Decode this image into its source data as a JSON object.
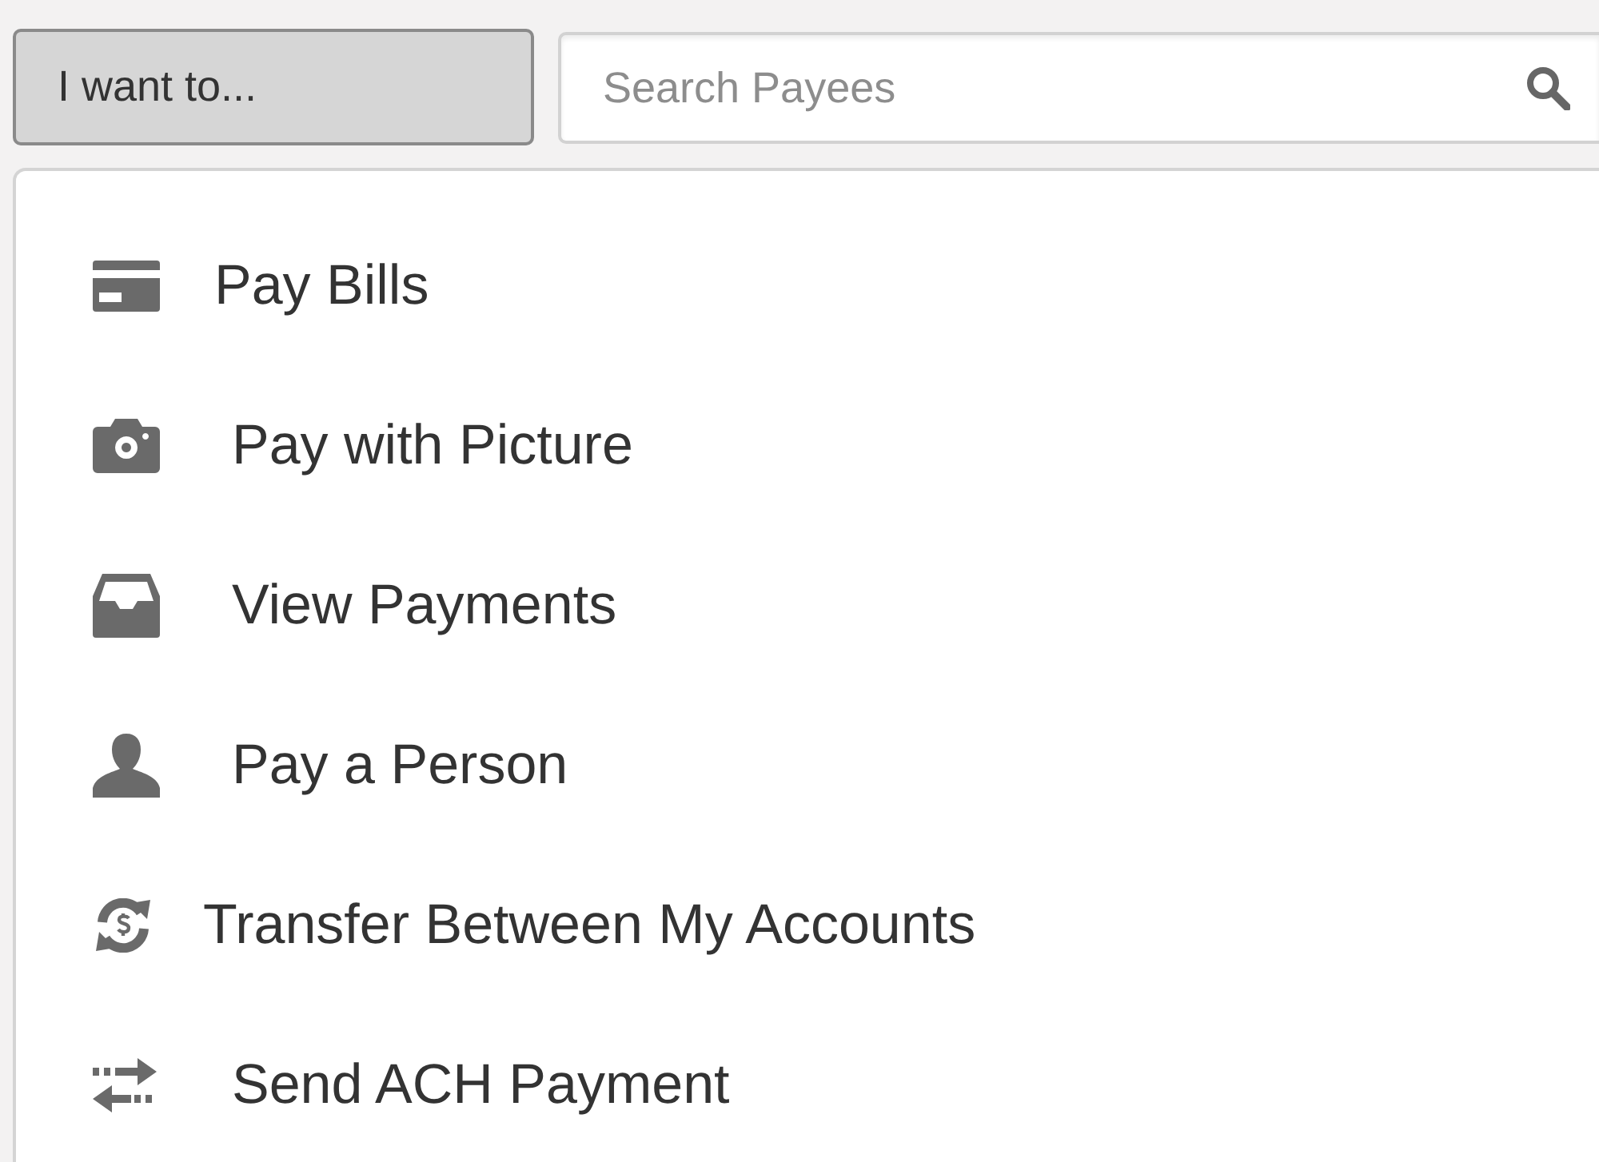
{
  "action_button": {
    "label": "I want to..."
  },
  "search": {
    "placeholder": "Search Payees"
  },
  "menu": {
    "items": [
      {
        "kind": "card",
        "label": "Pay Bills"
      },
      {
        "kind": "camera",
        "label": "Pay with Picture"
      },
      {
        "kind": "tray",
        "label": "View Payments"
      },
      {
        "kind": "person",
        "label": "Pay a Person"
      },
      {
        "kind": "transfer",
        "label": "Transfer Between My Accounts"
      },
      {
        "kind": "exchange",
        "label": "Send ACH Payment"
      }
    ]
  }
}
